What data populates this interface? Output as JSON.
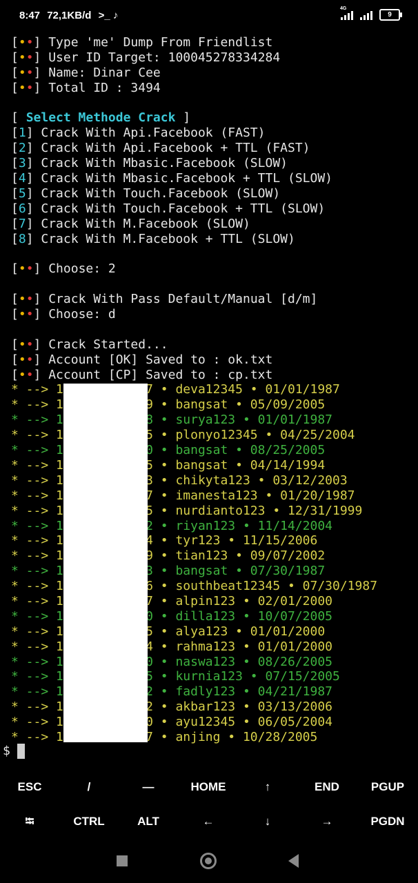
{
  "status_bar": {
    "time": "8:47",
    "net_speed": "72,1KB/d",
    "extra_icons": ">_ ♪",
    "network_type": "4G",
    "battery": "9"
  },
  "terminal": {
    "header": [
      "Type 'me' Dump From Friendlist",
      "User ID Target: 100045278334284",
      "Name: Dinar Cee",
      "Total ID : 3494"
    ],
    "select_title": "Select Methode Crack",
    "menu": [
      {
        "num": "1",
        "label": "Crack With Api.Facebook (FAST)"
      },
      {
        "num": "2",
        "label": "Crack With Api.Facebook + TTL (FAST)"
      },
      {
        "num": "3",
        "label": "Crack With Mbasic.Facebook (SLOW)"
      },
      {
        "num": "4",
        "label": "Crack With Mbasic.Facebook + TTL (SLOW)"
      },
      {
        "num": "5",
        "label": "Crack With Touch.Facebook (SLOW)"
      },
      {
        "num": "6",
        "label": "Crack With Touch.Facebook + TTL (SLOW)"
      },
      {
        "num": "7",
        "label": "Crack With M.Facebook (SLOW)"
      },
      {
        "num": "8",
        "label": "Crack With M.Facebook + TTL (SLOW)"
      }
    ],
    "choose1": "Choose: 2",
    "pass_prompt": "Crack With Pass Default/Manual [d/m]",
    "choose2": "Choose: d",
    "started": [
      "Crack Started...",
      "Account [OK] Saved to : ok.txt",
      "Account [CP] Saved to : cp.txt"
    ],
    "results": [
      {
        "status": "cp",
        "prefix": "* --> 1",
        "id_end": "647",
        "text": "deva12345 • 01/01/1987"
      },
      {
        "status": "cp",
        "prefix": "* --> 1",
        "id_end": "319",
        "text": "bangsat • 05/09/2005"
      },
      {
        "status": "ok",
        "prefix": "* --> 1",
        "id_end": "588",
        "text": "surya123 • 01/01/1987"
      },
      {
        "status": "cp",
        "prefix": "* --> 1",
        "id_end": "515",
        "text": "plonyo12345 • 04/25/2004"
      },
      {
        "status": "ok",
        "prefix": "* --> 1",
        "id_end": "830",
        "text": "bangsat • 08/25/2005"
      },
      {
        "status": "cp",
        "prefix": "* --> 1",
        "id_end": "385",
        "text": "bangsat • 04/14/1994"
      },
      {
        "status": "cp",
        "prefix": "* --> 1",
        "id_end": "483",
        "text": "chikyta123 • 03/12/2003"
      },
      {
        "status": "cp",
        "prefix": "* --> 1",
        "id_end": "527",
        "text": "imanesta123 • 01/20/1987"
      },
      {
        "status": "cp",
        "prefix": "* --> 1",
        "id_end": "235",
        "text": "nurdianto123 • 12/31/1999"
      },
      {
        "status": "ok",
        "prefix": "* --> 1",
        "id_end": "152",
        "text": "riyan123 • 11/14/2004"
      },
      {
        "status": "cp",
        "prefix": "* --> 1",
        "id_end": "284",
        "text": "tyr123 • 11/15/2006"
      },
      {
        "status": "cp",
        "prefix": "* --> 1",
        "id_end": "439",
        "text": "tian123 • 09/07/2002"
      },
      {
        "status": "ok",
        "prefix": "* --> 1",
        "id_end": "043",
        "text": "bangsat • 07/30/1987"
      },
      {
        "status": "cp",
        "prefix": "* --> 1",
        "id_end": "996",
        "text": "southbeat12345 • 07/30/1987"
      },
      {
        "status": "cp",
        "prefix": "* --> 1",
        "id_end": "057",
        "text": "alpin123 • 02/01/2000"
      },
      {
        "status": "ok",
        "prefix": "* --> 1",
        "id_end": "370",
        "text": "dilla123 • 10/07/2005"
      },
      {
        "status": "cp",
        "prefix": "* --> 1",
        "id_end": "165",
        "text": "alya123 • 01/01/2000"
      },
      {
        "status": "cp",
        "prefix": "* --> 1",
        "id_end": "124",
        "text": "rahma123 • 01/01/2000"
      },
      {
        "status": "ok",
        "prefix": "* --> 1",
        "id_end": "650",
        "text": "naswa123 • 08/26/2005"
      },
      {
        "status": "ok",
        "prefix": "* --> 1",
        "id_end": "355",
        "text": "kurnia123 • 07/15/2005"
      },
      {
        "status": "ok",
        "prefix": "* --> 1",
        "id_end": "052",
        "text": "fadly123 • 04/21/1987"
      },
      {
        "status": "cp",
        "prefix": "* --> 1",
        "id_end": "312",
        "text": "akbar123 • 03/13/2006"
      },
      {
        "status": "cp",
        "prefix": "* --> 1",
        "id_end": "360",
        "text": "ayu12345 • 06/05/2004"
      },
      {
        "status": "cp",
        "prefix": "* --> 1",
        "id_end": "947",
        "text": "anjing • 10/28/2005"
      }
    ],
    "prompt": "$"
  },
  "extra_keys": {
    "row1": [
      "ESC",
      "/",
      "—",
      "HOME",
      "↑",
      "END",
      "PGUP"
    ],
    "row2": [
      "⭾",
      "CTRL",
      "ALT",
      "←",
      "↓",
      "→",
      "PGDN"
    ]
  },
  "colors": {
    "ok": "#3fb23f",
    "cp": "#d6cf4a",
    "cyan": "#3cc8d8",
    "dot_yellow": "#e8b400",
    "dot_red": "#e23b3b"
  }
}
